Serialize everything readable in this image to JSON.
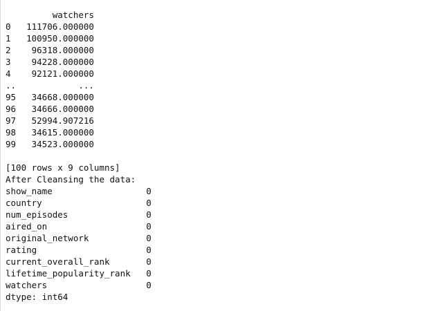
{
  "console": {
    "header": "         watchers",
    "rows": [
      "0   111706.000000",
      "1   100950.000000",
      "2    96318.000000",
      "3    94228.000000",
      "4    92121.000000",
      "..            ...",
      "95   34668.000000",
      "96   34666.000000",
      "97   52994.907216",
      "98   34615.000000",
      "99   34523.000000"
    ],
    "shape_line": "[100 rows x 9 columns]",
    "cleansing_heading": "After Cleansing the data:",
    "null_counts": [
      "show_name                  0",
      "country                    0",
      "num_episodes               0",
      "aired_on                   0",
      "original_network           0",
      "rating                     0",
      "current_overall_rank       0",
      "lifetime_popularity_rank   0",
      "watchers                   0"
    ],
    "dtype_line": "dtype: int64"
  }
}
